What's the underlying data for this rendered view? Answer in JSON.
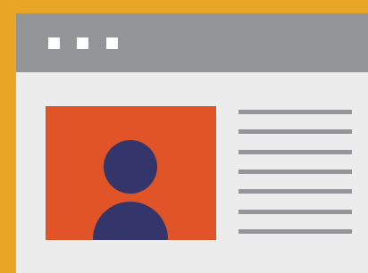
{
  "colors": {
    "frame_border": "#E8A526",
    "window_background": "#ECECEC",
    "titlebar": "#939598",
    "window_controls": "#FFFFFF",
    "photo_background": "#E05428",
    "avatar_silhouette": "#34366B",
    "text_placeholder_lines": "#939598"
  },
  "window": {
    "control_dot_count": 3
  },
  "profile": {
    "avatar_icon": "user-silhouette-icon",
    "placeholder_line_count": 7
  }
}
